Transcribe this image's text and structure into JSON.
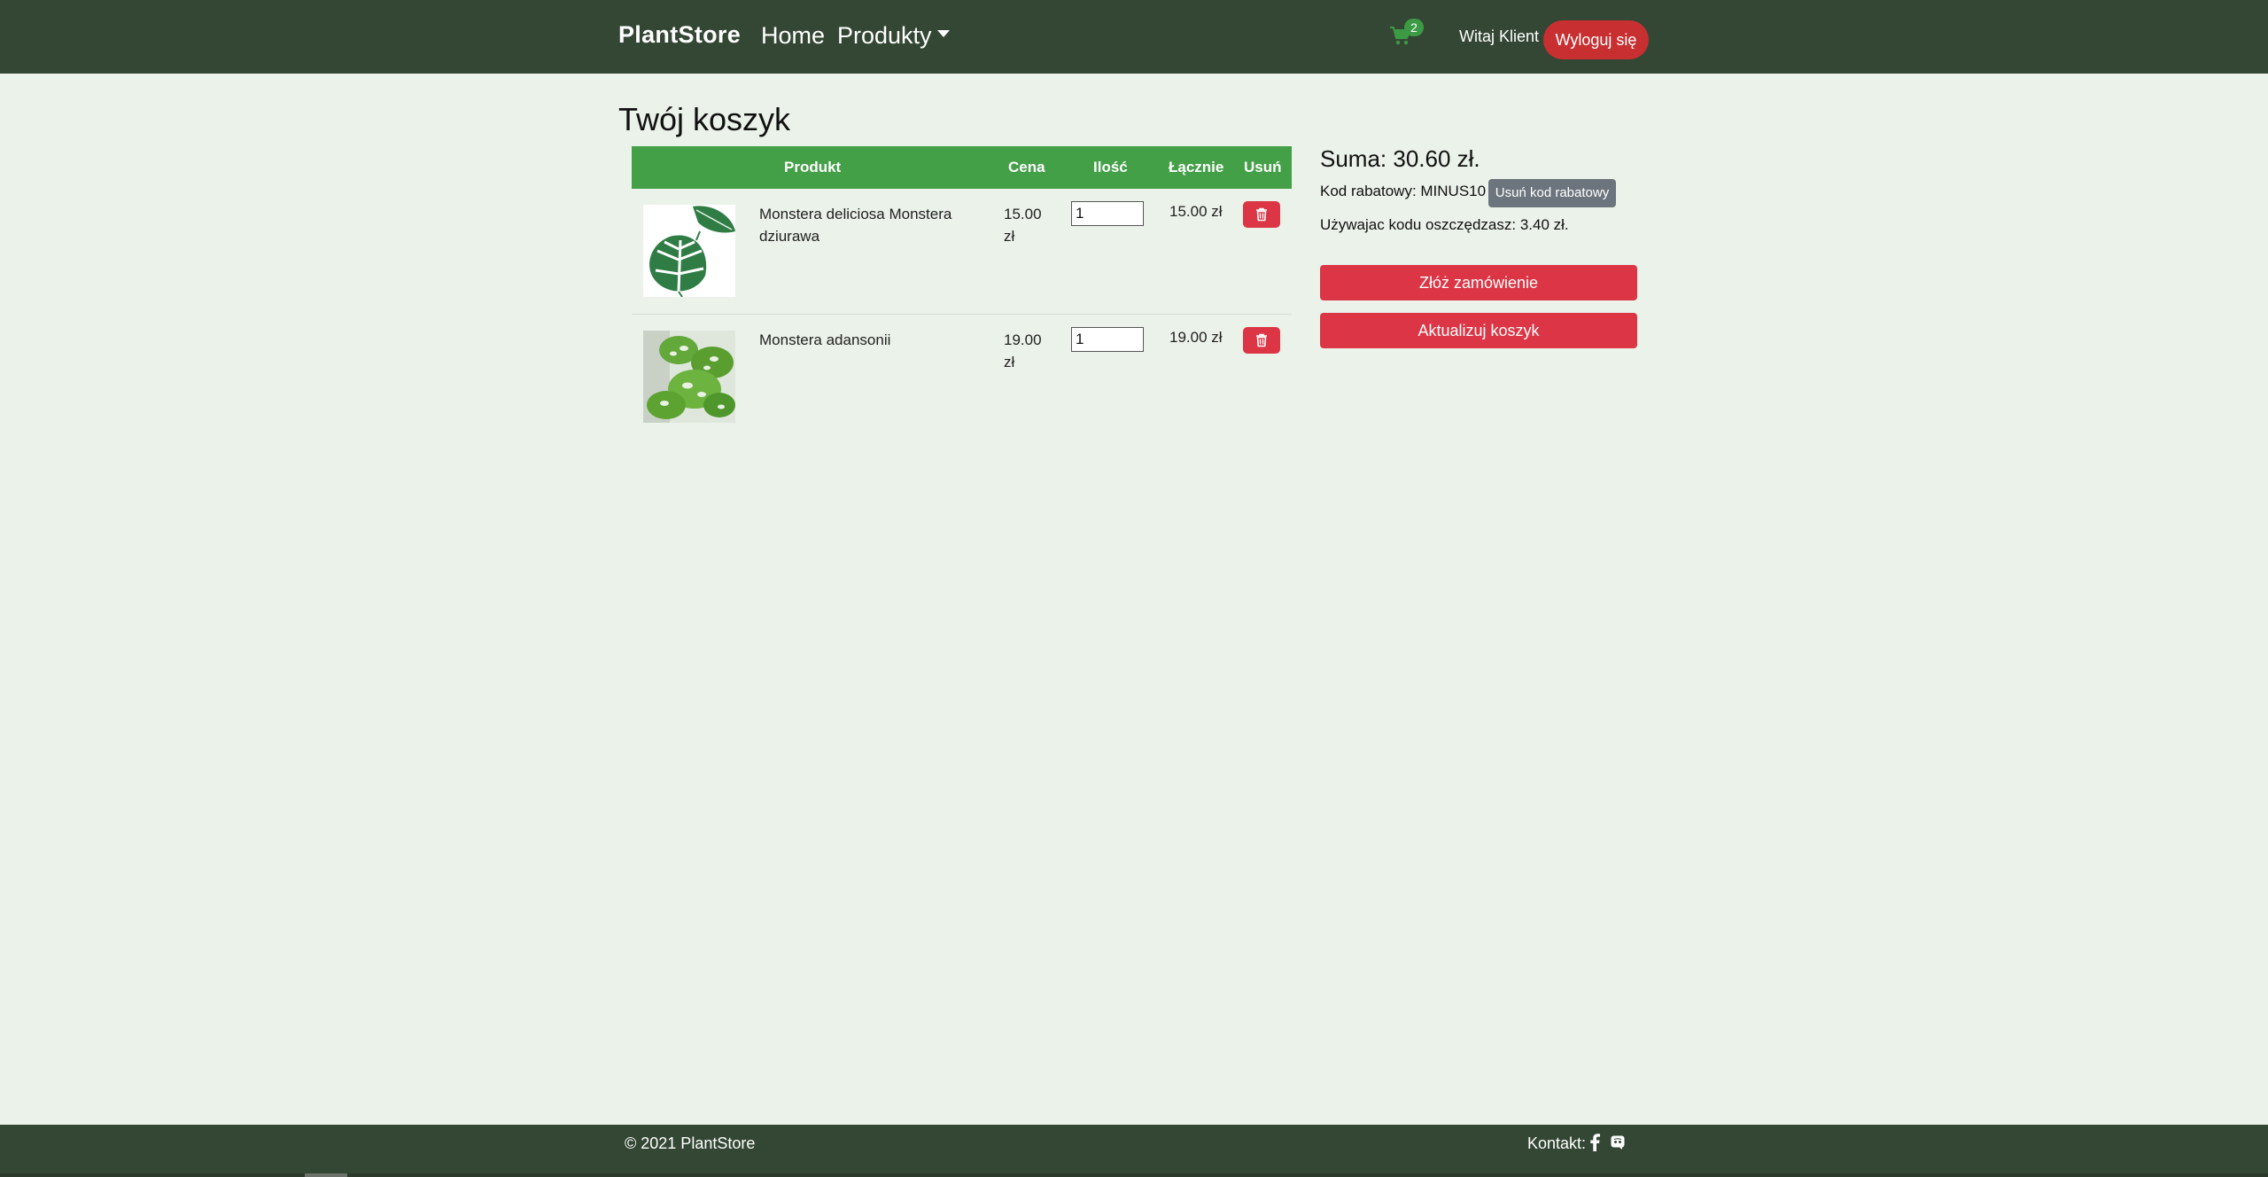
{
  "navbar": {
    "brand": "PlantStore",
    "home": "Home",
    "products": "Produkty",
    "cart_count": "2",
    "greeting": "Witaj Klient",
    "logout": "Wyloguj się"
  },
  "page_title": "Twój koszyk",
  "table": {
    "headers": {
      "product": "Produkt",
      "price": "Cena",
      "quantity": "Ilość",
      "total": "Łącznie",
      "remove": "Usuń"
    },
    "rows": [
      {
        "name": "Monstera deliciosa Monstera dziurawa",
        "price": "15.00 zł",
        "quantity": "1",
        "total": "15.00 zł",
        "image": "monstera-deliciosa-leaf"
      },
      {
        "name": "Monstera adansonii",
        "price": "19.00 zł",
        "quantity": "1",
        "total": "19.00 zł",
        "image": "monstera-adansonii-leaves"
      }
    ]
  },
  "summary": {
    "sum": "Suma: 30.60 zł.",
    "discount_code": "Kod rabatowy: MINUS10",
    "remove_code": "Usuń kod rabatowy",
    "savings": "Używajac kodu oszczędzasz: 3.40 zł.",
    "order_button": "Złóż zamówienie",
    "update_button": "Aktualizuj koszyk"
  },
  "footer": {
    "copyright": "© 2021 PlantStore",
    "contact": "Kontakt:",
    "icons": [
      "facebook-icon",
      "discord-icon"
    ]
  },
  "colors": {
    "navbar": "#344734",
    "background": "#ebf2e9",
    "table_header": "#43a047",
    "danger": "#dc3545",
    "logout": "#c82f31",
    "secondary": "#6c757d"
  }
}
